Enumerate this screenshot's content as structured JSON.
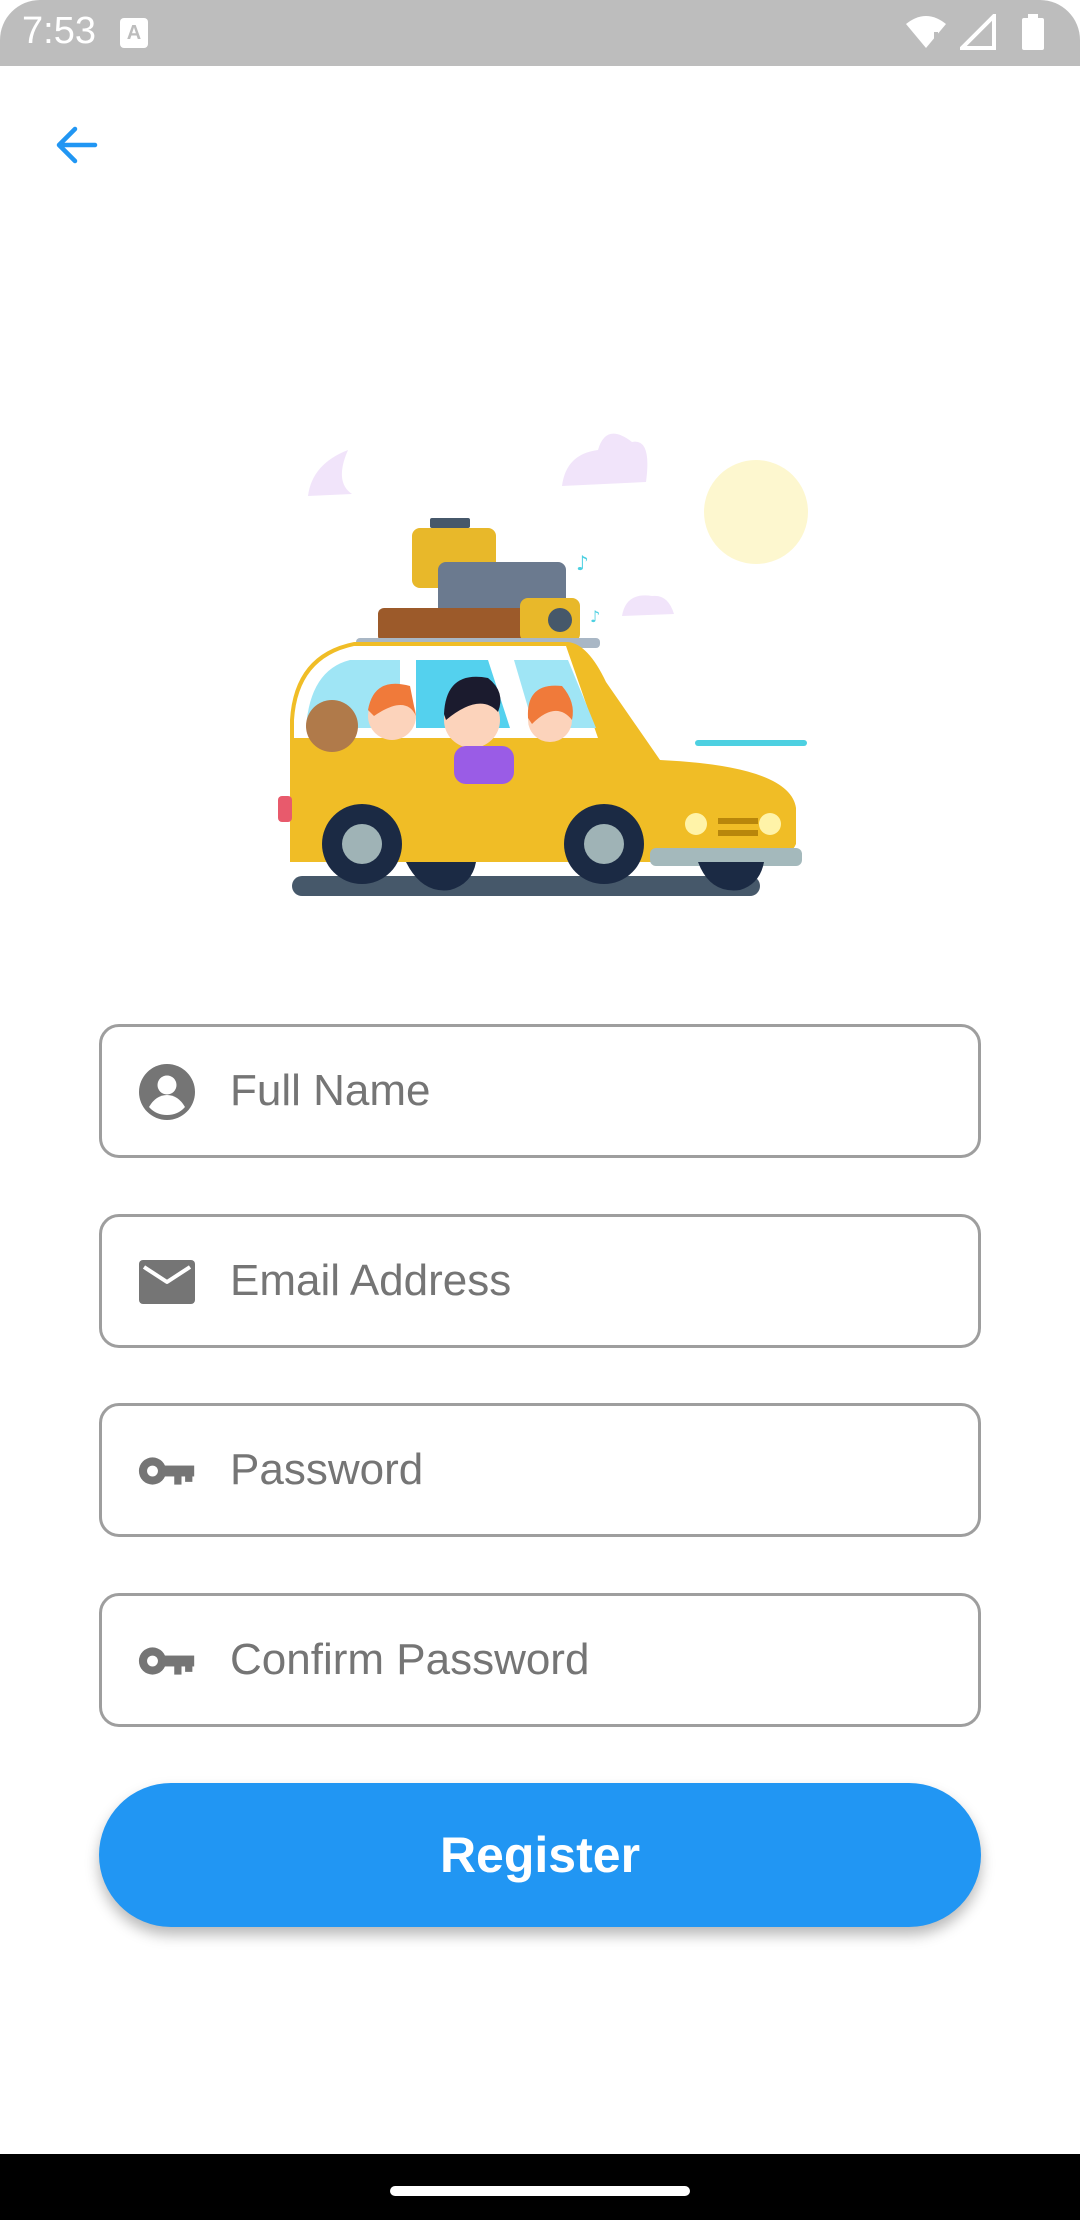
{
  "status_bar": {
    "time": "7:53",
    "notification_letter": "A",
    "icons": [
      "wifi-icon",
      "signal-icon",
      "battery-icon"
    ]
  },
  "header": {
    "back_icon": "arrow-back-icon"
  },
  "illustration": {
    "subject": "car-travel-illustration"
  },
  "form": {
    "full_name": {
      "placeholder": "Full Name",
      "value": "",
      "icon": "person-icon"
    },
    "email": {
      "placeholder": "Email Address",
      "value": "",
      "icon": "mail-icon"
    },
    "password": {
      "placeholder": "Password",
      "value": "",
      "icon": "key-icon"
    },
    "confirm_password": {
      "placeholder": "Confirm Password",
      "value": "",
      "icon": "key-icon"
    },
    "register_label": "Register"
  },
  "colors": {
    "accent": "#2196f3",
    "field_border": "#9e9e9e",
    "icon_gray": "#757575",
    "status_bar": "#bdbdbd"
  }
}
